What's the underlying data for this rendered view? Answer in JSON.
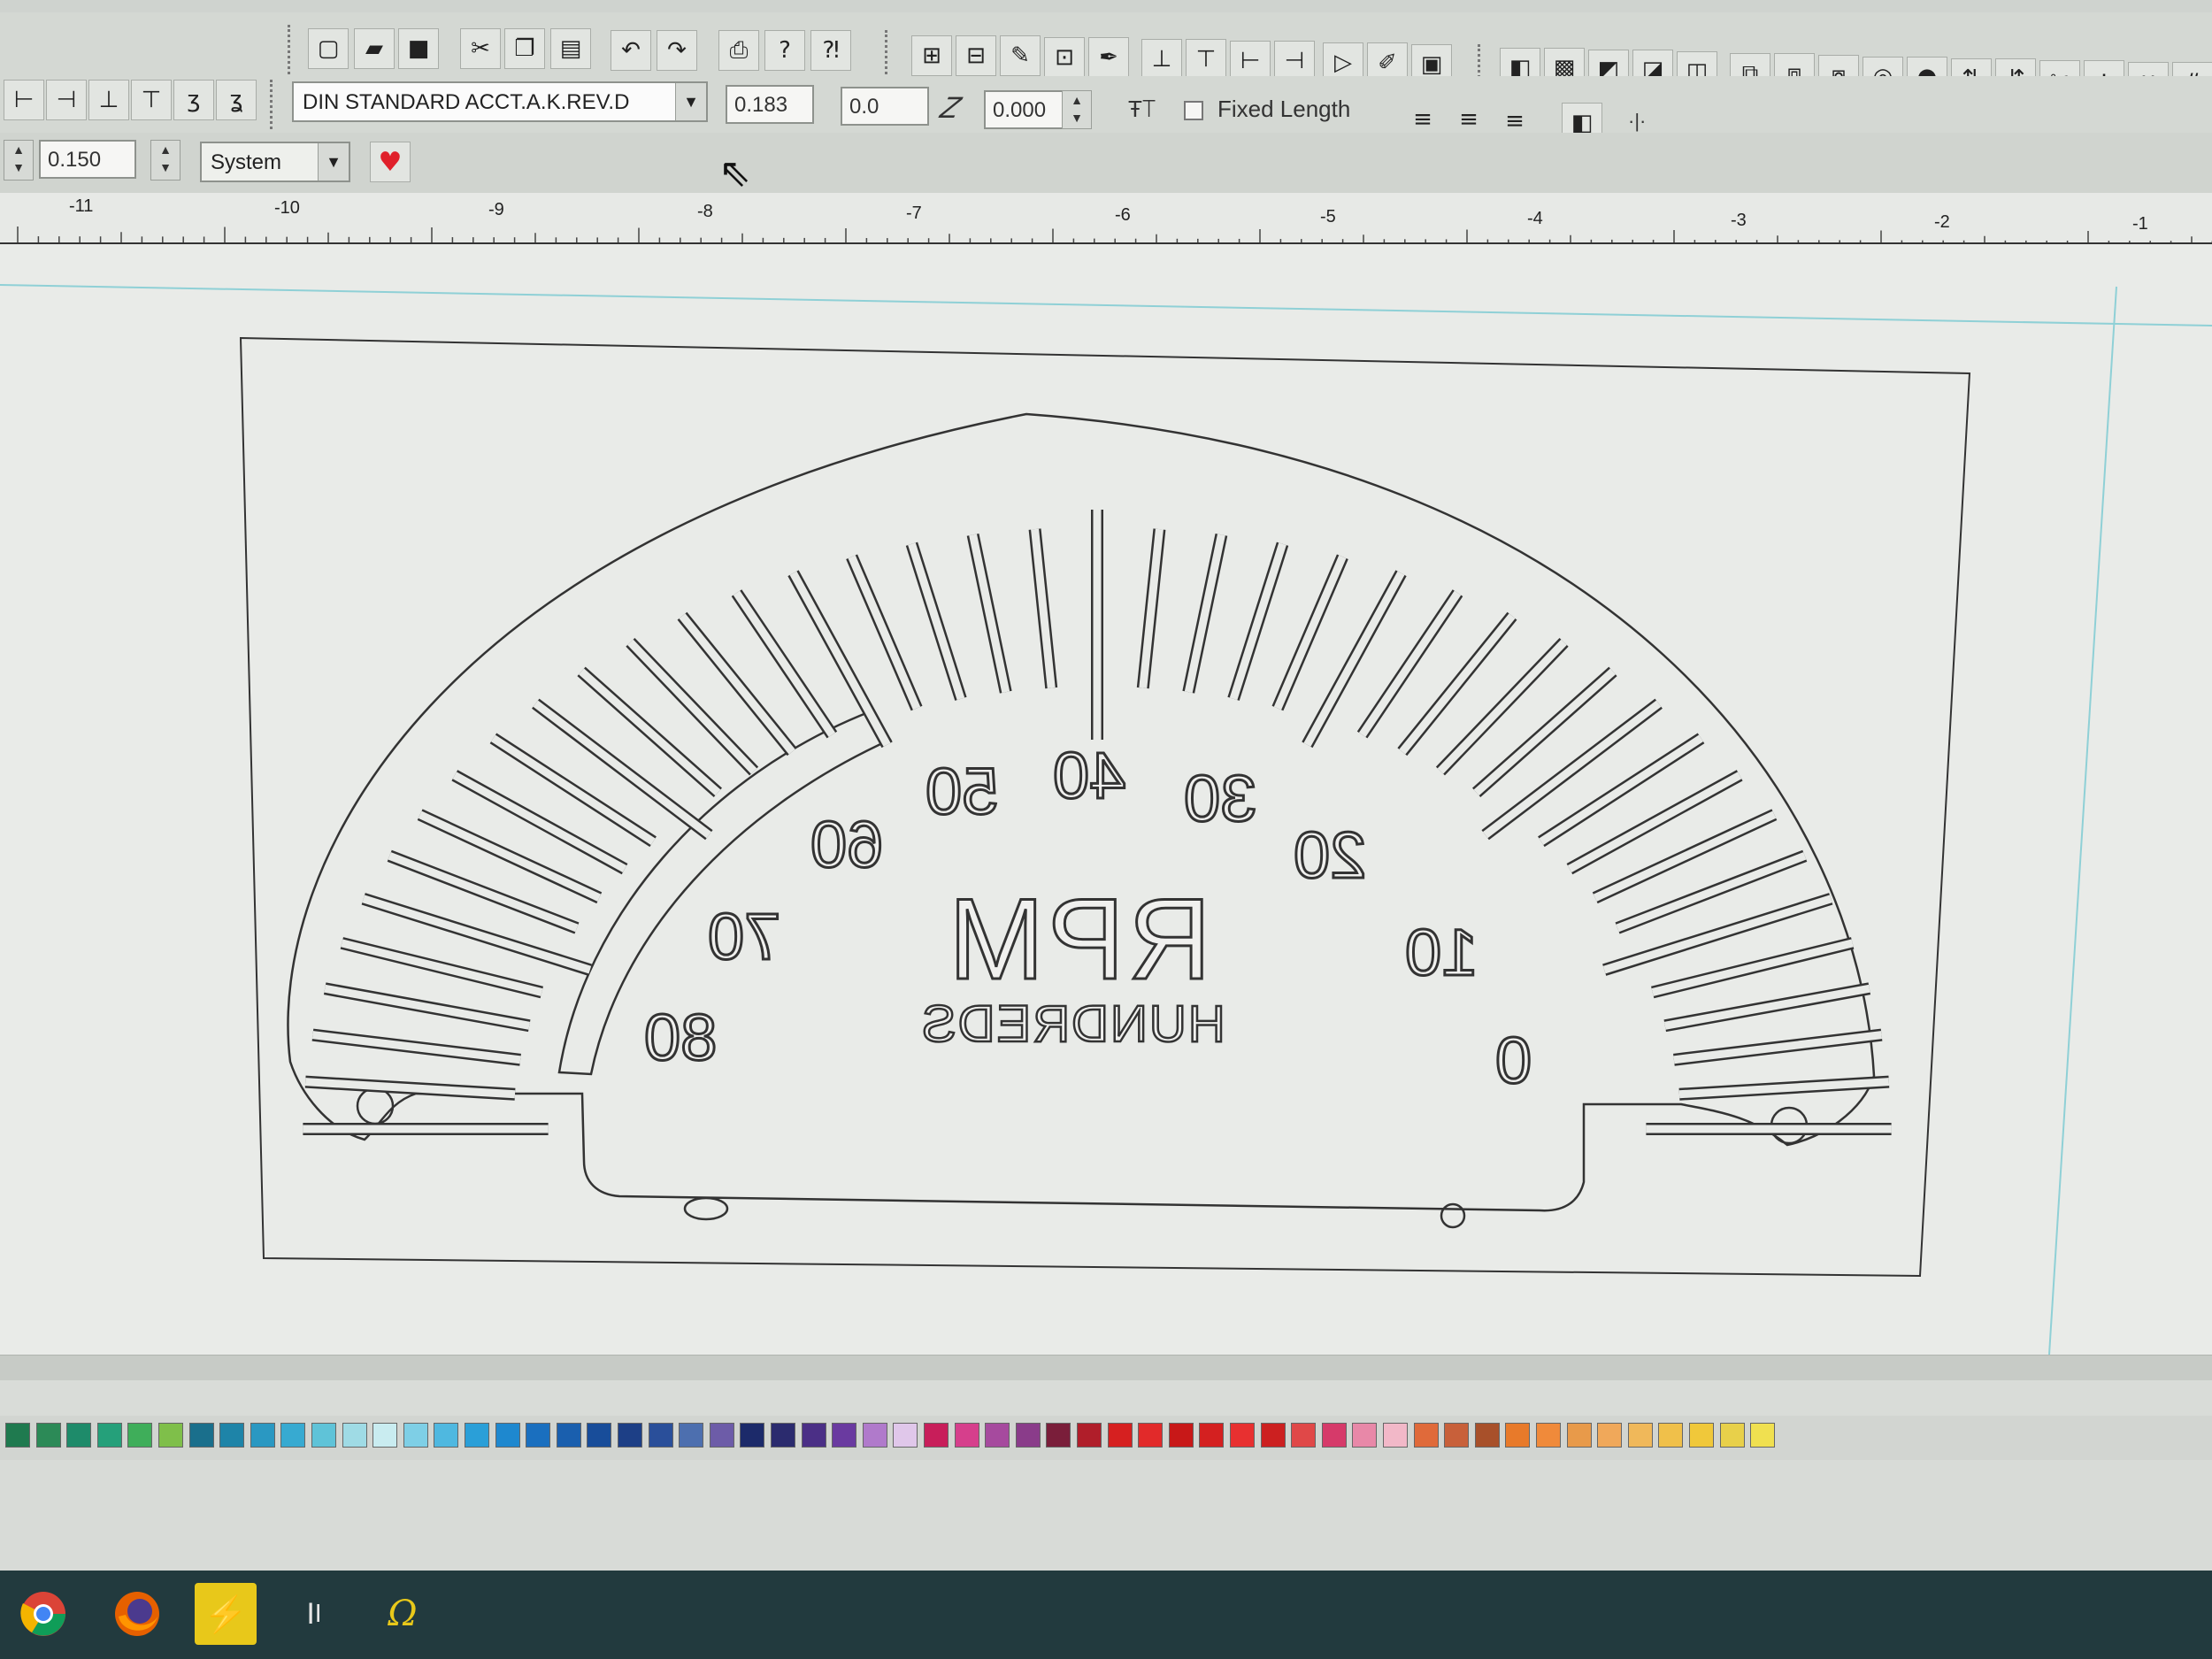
{
  "toolbar_main": {
    "font_name": "DIN STANDARD ACCT.A.K.REV.D",
    "text_height": "0.183",
    "char_spacing": "0.0",
    "slant": "0.000",
    "fixed_length_label": "Fixed Length",
    "fixed_length_checked": false
  },
  "toolbar_sub": {
    "line_width": "0.150",
    "font_source": "System"
  },
  "ruler": {
    "ticks": [
      "-11",
      "-10",
      "-9",
      "-8",
      "-7",
      "-6",
      "-5",
      "-4",
      "-3",
      "-2",
      "-1"
    ]
  },
  "gauge": {
    "numbers": [
      "80",
      "70",
      "60",
      "50",
      "40",
      "30",
      "20",
      "10",
      "0"
    ],
    "title": "RPM",
    "subtitle": "HUNDREDS"
  },
  "icons": {
    "favorite": "heart-icon",
    "cursor": "arrow-pointer-icon"
  },
  "taskbar": {
    "apps": [
      "chrome-icon",
      "firefox-icon",
      "engraving-app-icon",
      "text-tool-icon",
      "omega-app-icon"
    ]
  },
  "palette_colors": [
    "#1f7a4f",
    "#2c8a57",
    "#1e8b6a",
    "#25a07a",
    "#3fae5a",
    "#7fbf4a",
    "#1a6f8c",
    "#1e84a8",
    "#2a98c2",
    "#37aad1",
    "#5fc3d8",
    "#9fdbe5",
    "#c9ecf0",
    "#7ecfe6",
    "#4fb8e0",
    "#2a9fd8",
    "#1e88cf",
    "#1a6fbf",
    "#1a5fae",
    "#184d9a",
    "#1d3f86",
    "#2a4f9a",
    "#4d6faf",
    "#6d5ca8",
    "#1c2a6a",
    "#2b2b6e",
    "#4b2f86",
    "#6a3aa0",
    "#b07acb",
    "#e0c7ea",
    "#c81e5a",
    "#d63f8c",
    "#a64a9e",
    "#8a3c8a",
    "#7a1e3a",
    "#b01e2a",
    "#d62020",
    "#e22a2a",
    "#c81818",
    "#d42020",
    "#e83030",
    "#cc2020",
    "#e04848",
    "#d63a6a",
    "#e888a8",
    "#f2b8c8",
    "#e06a3a",
    "#c8603a",
    "#a8502a",
    "#e87a2a",
    "#f08a3a",
    "#e89a4a",
    "#f0a85a",
    "#f0b85a",
    "#f0c04a",
    "#f0c83a",
    "#e8d04a",
    "#f0e050"
  ]
}
